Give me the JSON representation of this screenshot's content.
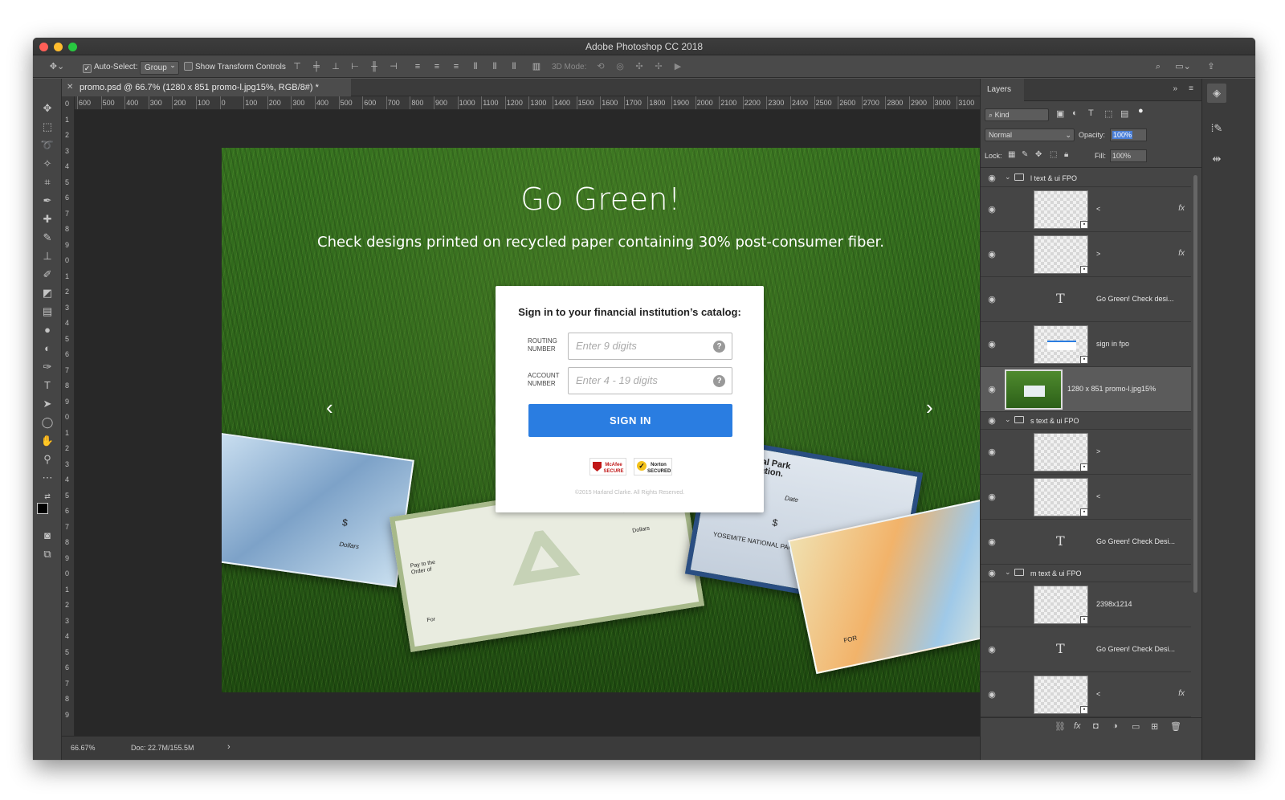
{
  "window": {
    "title": "Adobe Photoshop CC 2018",
    "colors": {
      "close": "#ff5f57",
      "minimize": "#febc2e",
      "zoom": "#28c840"
    }
  },
  "options_bar": {
    "auto_select_label": "Auto-Select:",
    "auto_select_value": "Group",
    "transform_controls_label": "Show Transform Controls",
    "mode_3d_label": "3D Mode:"
  },
  "document": {
    "tab_title": "promo.psd @ 66.7% (1280 x 851 promo-l.jpg15%, RGB/8#) *",
    "ruler_h_labels": [
      "600",
      "500",
      "400",
      "300",
      "200",
      "100",
      "0",
      "100",
      "200",
      "300",
      "400",
      "500",
      "600",
      "700",
      "800",
      "900",
      "1000",
      "1100",
      "1200",
      "1300",
      "1400",
      "1500",
      "1600",
      "1700",
      "1800",
      "1900",
      "2000",
      "2100",
      "2200",
      "2300",
      "2400",
      "2500",
      "2600",
      "2700",
      "2800",
      "2900",
      "3000",
      "3100"
    ],
    "ruler_v_labels": [
      "0",
      "1",
      "2",
      "3",
      "4",
      "5",
      "6",
      "7",
      "8",
      "9",
      "0",
      "1",
      "2",
      "3",
      "4",
      "5",
      "6",
      "7",
      "8",
      "9",
      "0",
      "1",
      "2",
      "3",
      "4",
      "5",
      "6",
      "7",
      "8",
      "9",
      "0",
      "1",
      "2",
      "3",
      "4",
      "5",
      "6",
      "7",
      "8",
      "9"
    ]
  },
  "canvas": {
    "headline": "Go Green!",
    "subhead": "Check designs printed on recycled paper containing 30% post-consumer fiber.",
    "prev_arrow": "‹",
    "next_arrow": "›",
    "signin": {
      "title": "Sign in to your financial institution’s catalog:",
      "routing_label": "Routing Number",
      "routing_placeholder": "Enter 9 digits",
      "account_label": "Account Number",
      "account_placeholder": "Enter 4 - 19 digits",
      "help_glyph": "?",
      "button_label": "SIGN IN",
      "badge_mcafee": "McAfee SECURE",
      "badge_norton": "Norton SECURED",
      "copyright": "©2015 Harland Clarke. All Rights Reserved."
    },
    "checks": {
      "dollar": "$",
      "pay_to": "Pay to the Order of",
      "dollars": "Dollars",
      "for": "For",
      "national_park": "National Park Foundation.",
      "date": "Date",
      "yosemite": "YOSEMITE NATIONAL PARK",
      "for_caps": "FOR"
    },
    "colors": {
      "button": "#2a7de1"
    }
  },
  "status_bar": {
    "zoom": "66.67%",
    "doc_size": "Doc: 22.7M/155.5M",
    "arrow": "›"
  },
  "layers_panel": {
    "title": "Layers",
    "filter_kind": "Kind",
    "blend_mode": "Normal",
    "opacity_label": "Opacity:",
    "opacity_value": "100%",
    "lock_label": "Lock:",
    "fill_label": "Fill:",
    "fill_value": "100%",
    "rows": [
      {
        "name": "l text & ui FPO",
        "kind": "group"
      },
      {
        "name": "<",
        "kind": "smart",
        "fx": "fx"
      },
      {
        "name": ">",
        "kind": "smart",
        "fx": "fx"
      },
      {
        "name": "Go Green! Check desi...",
        "kind": "text"
      },
      {
        "name": "sign in fpo",
        "kind": "smart"
      },
      {
        "name": "1280 x 851 promo-l.jpg15%",
        "kind": "image"
      },
      {
        "name": "s text & ui FPO",
        "kind": "group"
      },
      {
        "name": ">",
        "kind": "smart"
      },
      {
        "name": "<",
        "kind": "smart"
      },
      {
        "name": "Go Green! Check Desi...",
        "kind": "text"
      },
      {
        "name": "m text & ui FPO",
        "kind": "group"
      },
      {
        "name": "2398x1214",
        "kind": "smart"
      },
      {
        "name": "Go Green! Check Desi...",
        "kind": "text"
      },
      {
        "name": "<",
        "kind": "smart",
        "fx": "fx"
      }
    ]
  }
}
